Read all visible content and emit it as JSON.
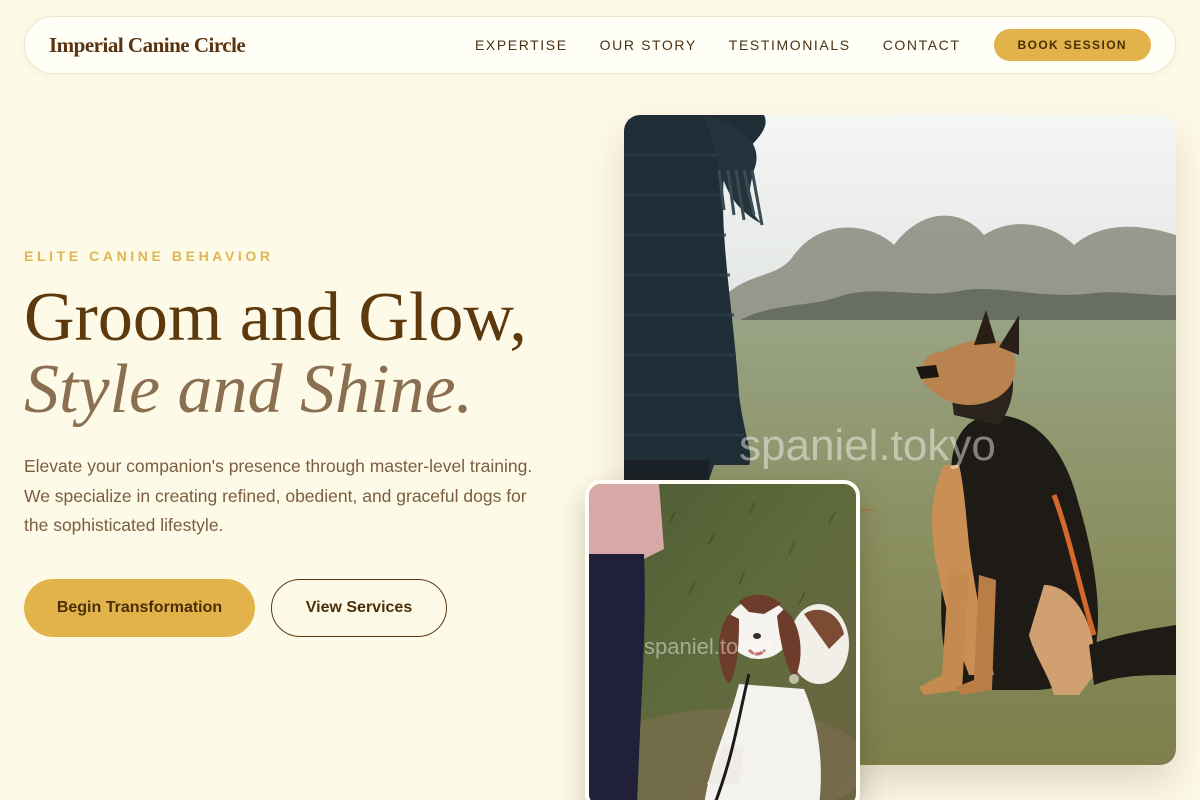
{
  "header": {
    "brand": "Imperial Canine Circle",
    "nav": [
      {
        "label": "EXPERTISE"
      },
      {
        "label": "OUR STORY"
      },
      {
        "label": "TESTIMONIALS"
      },
      {
        "label": "CONTACT"
      }
    ],
    "cta_label": "BOOK SESSION"
  },
  "hero": {
    "eyebrow": "ELITE CANINE BEHAVIOR",
    "headline_line1": "Groom and Glow,",
    "headline_line2": "Style and Shine.",
    "lead": "Elevate your companion's presence through master-level training. We specialize in creating refined, obedient, and graceful dogs for the sophisticated lifestyle.",
    "primary_button": "Begin Transformation",
    "secondary_button": "View Services"
  },
  "images": {
    "main_watermark": "spaniel.tokyo",
    "small_watermark": "spaniel.tokyo"
  },
  "colors": {
    "background": "#fefae8",
    "accent": "#e2b34a",
    "heading": "#5c3a0e",
    "heading_italic": "#8a7050",
    "body_text": "#7b5e3f"
  }
}
